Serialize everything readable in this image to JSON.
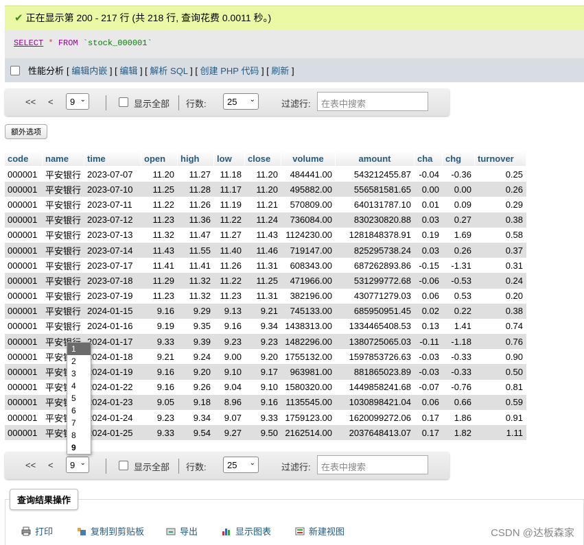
{
  "message": "正在显示第 200 - 217 行 (共 218 行, 查询花费 0.0011 秒。)",
  "sql": {
    "select": "SELECT",
    "star": "*",
    "from": "FROM",
    "table": "`stock_000001`"
  },
  "perf": {
    "label": "性能分析",
    "links": [
      "编辑内嵌",
      "编辑",
      "解析 SQL",
      "创建 PHP 代码",
      "刷新"
    ]
  },
  "nav": {
    "first": "<<",
    "prev": "<",
    "page": "9",
    "show_all": "显示全部",
    "rows_label": "行数:",
    "rows_value": "25",
    "filter_label": "过滤行:",
    "filter_placeholder": "在表中搜索"
  },
  "extra_options": "额外选项",
  "columns": [
    "code",
    "name",
    "time",
    "open",
    "high",
    "low",
    "close",
    "volume",
    "amount",
    "cha",
    "chg",
    "turnover"
  ],
  "rows": [
    [
      "000001",
      "平安银行",
      "2023-07-07",
      "11.20",
      "11.27",
      "11.18",
      "11.20",
      "484441.00",
      "543212455.87",
      "-0.04",
      "-0.36",
      "0.25"
    ],
    [
      "000001",
      "平安银行",
      "2023-07-10",
      "11.25",
      "11.28",
      "11.17",
      "11.20",
      "495882.00",
      "556581581.65",
      "0.00",
      "0.00",
      "0.26"
    ],
    [
      "000001",
      "平安银行",
      "2023-07-11",
      "11.22",
      "11.26",
      "11.19",
      "11.21",
      "570809.00",
      "640131787.10",
      "0.01",
      "0.09",
      "0.29"
    ],
    [
      "000001",
      "平安银行",
      "2023-07-12",
      "11.23",
      "11.36",
      "11.22",
      "11.24",
      "736084.00",
      "830230820.88",
      "0.03",
      "0.27",
      "0.38"
    ],
    [
      "000001",
      "平安银行",
      "2023-07-13",
      "11.32",
      "11.47",
      "11.27",
      "11.43",
      "1124230.00",
      "1281848378.91",
      "0.19",
      "1.69",
      "0.58"
    ],
    [
      "000001",
      "平安银行",
      "2023-07-14",
      "11.43",
      "11.55",
      "11.40",
      "11.46",
      "719147.00",
      "825295738.24",
      "0.03",
      "0.26",
      "0.37"
    ],
    [
      "000001",
      "平安银行",
      "2023-07-17",
      "11.41",
      "11.41",
      "11.26",
      "11.31",
      "608343.00",
      "687262893.86",
      "-0.15",
      "-1.31",
      "0.31"
    ],
    [
      "000001",
      "平安银行",
      "2023-07-18",
      "11.29",
      "11.32",
      "11.22",
      "11.25",
      "471966.00",
      "531299772.68",
      "-0.06",
      "-0.53",
      "0.24"
    ],
    [
      "000001",
      "平安银行",
      "2023-07-19",
      "11.23",
      "11.32",
      "11.23",
      "11.31",
      "382196.00",
      "430771279.03",
      "0.06",
      "0.53",
      "0.20"
    ],
    [
      "000001",
      "平安银行",
      "2024-01-15",
      "9.16",
      "9.29",
      "9.13",
      "9.21",
      "745133.00",
      "685950951.45",
      "0.02",
      "0.22",
      "0.38"
    ],
    [
      "000001",
      "平安银行",
      "2024-01-16",
      "9.19",
      "9.35",
      "9.16",
      "9.34",
      "1438313.00",
      "1334465408.53",
      "0.13",
      "1.41",
      "0.74"
    ],
    [
      "000001",
      "平安银行",
      "2024-01-17",
      "9.33",
      "9.39",
      "9.23",
      "9.23",
      "1482296.00",
      "1380725065.03",
      "-0.11",
      "-1.18",
      "0.76"
    ],
    [
      "000001",
      "平安银行",
      "2024-01-18",
      "9.21",
      "9.24",
      "9.00",
      "9.20",
      "1755132.00",
      "1597853726.63",
      "-0.03",
      "-0.33",
      "0.90"
    ],
    [
      "000001",
      "平安银行",
      "2024-01-19",
      "9.16",
      "9.20",
      "9.10",
      "9.17",
      "963981.00",
      "881865023.89",
      "-0.03",
      "-0.33",
      "0.50"
    ],
    [
      "000001",
      "平安银行",
      "2024-01-22",
      "9.16",
      "9.26",
      "9.04",
      "9.10",
      "1580320.00",
      "1449858241.68",
      "-0.07",
      "-0.76",
      "0.81"
    ],
    [
      "000001",
      "平安银行",
      "2024-01-23",
      "9.05",
      "9.18",
      "8.96",
      "9.16",
      "1135545.00",
      "1030898421.04",
      "0.06",
      "0.66",
      "0.59"
    ],
    [
      "000001",
      "平安银行",
      "2024-01-24",
      "9.23",
      "9.34",
      "9.07",
      "9.33",
      "1759123.00",
      "1620099272.06",
      "0.17",
      "1.86",
      "0.91"
    ],
    [
      "000001",
      "平安银行",
      "2024-01-25",
      "9.33",
      "9.54",
      "9.27",
      "9.50",
      "2162514.00",
      "2037648413.07",
      "0.17",
      "1.82",
      "1.11"
    ]
  ],
  "dropdown": [
    "1",
    "2",
    "3",
    "4",
    "5",
    "6",
    "7",
    "8",
    "9"
  ],
  "ops_title": "查询结果操作",
  "ops": [
    {
      "icon": "print-icon",
      "label": "打印"
    },
    {
      "icon": "clipboard-icon",
      "label": "复制到剪贴板"
    },
    {
      "icon": "export-icon",
      "label": "导出"
    },
    {
      "icon": "chart-icon",
      "label": "显示图表"
    },
    {
      "icon": "view-icon",
      "label": "新建视图"
    }
  ],
  "watermark": "CSDN @达板森家"
}
